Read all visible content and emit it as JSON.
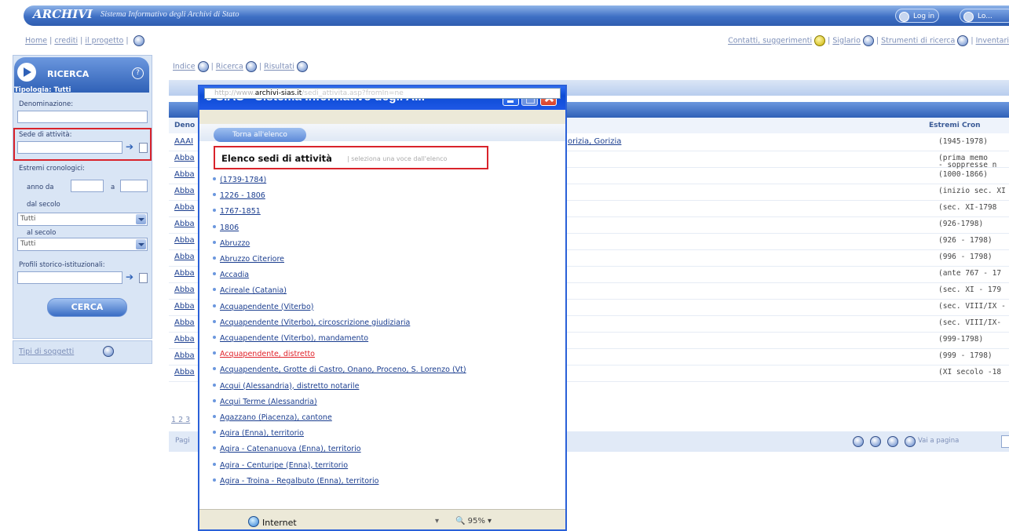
{
  "header": {
    "logo": "ARCHIVI",
    "subtitle": "Sistema Informativo degli Archivi di Stato",
    "btn1": "Log in",
    "btn2": "Lo..."
  },
  "nav_links": {
    "left": [
      "Home",
      "crediti",
      "il progetto"
    ],
    "right": [
      "Contatti, suggerimenti",
      "Siglario",
      "Strumenti di ricerca",
      "Inventari"
    ]
  },
  "sidebar": {
    "title": "RICERCA",
    "tipologie": "Tipologia: Tutti",
    "denominazione": "Denominazione:",
    "sede": "Sede di attività:",
    "estremi": "Estremi cronologici:",
    "anno_da": "anno da",
    "anno_a": "a",
    "dal_secolo": "dal secolo",
    "al_secolo": "al secolo",
    "sel_value": "Tutti",
    "profili": "Profili storico-istituzionali:",
    "cerca": "CERCA",
    "foot_link": "Tipi di soggetti"
  },
  "main": {
    "tabs": [
      "Indice",
      "Ricerca",
      "Risultati"
    ],
    "col_den": "Deno",
    "col_ext": "Estremi Cron",
    "rows": [
      {
        "name": "AAAI",
        "ext": "(1945-1978)",
        "mid": "orizia, Gorizia"
      },
      {
        "name": "Abba",
        "ext": "(prima memo",
        "ext2": "- soppresse n"
      },
      {
        "name": "Abba",
        "ext": "(1000-1866)"
      },
      {
        "name": "Abba",
        "ext": "(inizio sec. XI"
      },
      {
        "name": "Abba",
        "ext": "(sec. XI-1798"
      },
      {
        "name": "Abba",
        "ext": "(926-1798)"
      },
      {
        "name": "Abba",
        "ext": "(926 - 1798)"
      },
      {
        "name": "Abba",
        "ext": "(996 - 1798)"
      },
      {
        "name": "Abba",
        "ext": "(ante 767 - 17"
      },
      {
        "name": "Abba",
        "ext": "(sec. XI - 179"
      },
      {
        "name": "Abba",
        "ext": "(sec. VIII/IX -"
      },
      {
        "name": "Abba",
        "ext": "(sec. VIII/IX-"
      },
      {
        "name": "Abba",
        "ext": "(999-1798)"
      },
      {
        "name": "Abba",
        "ext": "(999 - 1798)"
      },
      {
        "name": "Abba",
        "ext": "(XI secolo -18"
      }
    ],
    "pager_left": "1 2 3",
    "pager_label": "Pagi",
    "pager_right": "Vai a pagina"
  },
  "popup": {
    "title": "SIAS - Sistema Informativo degli A...",
    "url_pre": "http://www.",
    "url_host": "archivi-sias.it",
    "url_post": "/sedi_attivita.asp?fromIn=ne",
    "pill": "Torna all'elenco",
    "list_title": "Elenco sedi di attività",
    "list_sub": "| seleziona una voce dall'elenco",
    "items": [
      "(1739-1784)",
      "1226 - 1806",
      "1767-1851",
      "1806",
      "Abruzzo",
      "Abruzzo Citeriore",
      "Accadia",
      "Acireale (Catania)",
      "Acquapendente (Viterbo)",
      "Acquapendente (Viterbo), circoscrizione giudiziaria",
      "Acquapendente (Viterbo), mandamento",
      "Acquapendente, distretto",
      "Acquapendente, Grotte di Castro, Onano, Proceno, S. Lorenzo (Vt)",
      "Acqui (Alessandria), distretto notarile",
      "Acqui Terme (Alessandria)",
      "Agazzano (Piacenza), cantone",
      "Agira (Enna), territorio",
      "Agira - Catenanuova (Enna), territorio",
      "Agira - Centuripe (Enna), territorio",
      "Agira - Troina - Regalbuto (Enna), territorio"
    ],
    "highlight_index": 11,
    "status": "Internet",
    "zoom": "95%"
  },
  "colors": {
    "accent": "#2f61b7",
    "highlight": "#d9232b",
    "xp_title": "#0c4bd5"
  }
}
